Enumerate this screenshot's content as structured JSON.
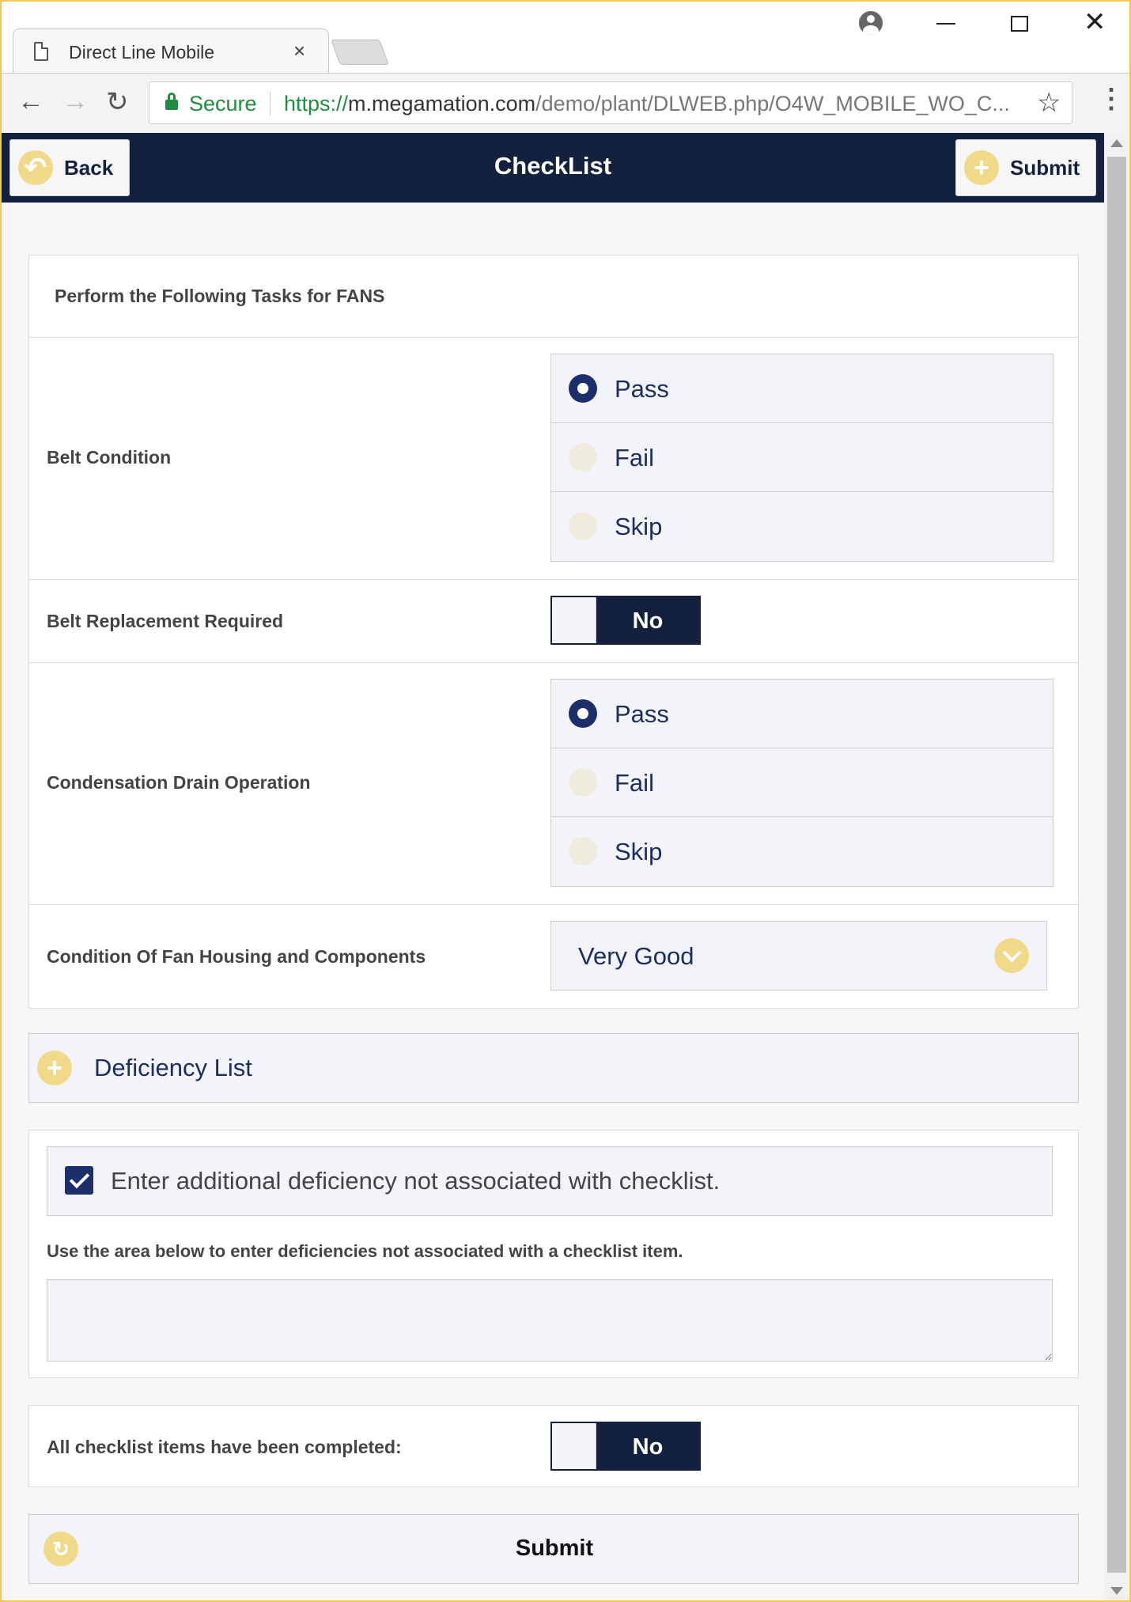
{
  "browser": {
    "tab_title": "Direct Line Mobile",
    "tab_close": "×",
    "secure_label": "Secure",
    "url_scheme": "https://",
    "url_host": "m.megamation.com",
    "url_path": "/demo/plant/DLWEB.php/O4W_MOBILE_WO_C...",
    "nav_back": "←",
    "nav_forward": "→",
    "nav_reload": "↻",
    "star": "☆",
    "menu": "⋮",
    "close_glyph": "✕"
  },
  "header": {
    "title": "CheckList",
    "back_label": "Back",
    "submit_label": "Submit",
    "back_icon": "↶",
    "submit_icon": "+"
  },
  "checklist": {
    "heading": "Perform the Following Tasks for FANS",
    "belt_condition": {
      "label": "Belt Condition",
      "options": [
        "Pass",
        "Fail",
        "Skip"
      ],
      "selected": "Pass"
    },
    "belt_replacement": {
      "label": "Belt Replacement Required",
      "value": "No"
    },
    "condensation_drain": {
      "label": "Condensation Drain Operation",
      "options": [
        "Pass",
        "Fail",
        "Skip"
      ],
      "selected": "Pass"
    },
    "fan_housing": {
      "label": "Condition Of Fan Housing and Components",
      "value": "Very Good"
    }
  },
  "deficiency_list": {
    "label": "Deficiency List",
    "icon": "+"
  },
  "additional": {
    "checkbox_label": "Enter additional deficiency not associated with checklist.",
    "checked": true,
    "hint": "Use the area below to enter deficiencies not associated with a checklist item.",
    "textarea_value": ""
  },
  "completion": {
    "label": "All checklist items have been completed:",
    "value": "No"
  },
  "footer": {
    "submit_label": "Submit",
    "submit_icon": "↻"
  },
  "colors": {
    "header_bg": "#13213f",
    "accent_yellow": "#f1d98a",
    "radio_selected": "#1c2f6b"
  }
}
